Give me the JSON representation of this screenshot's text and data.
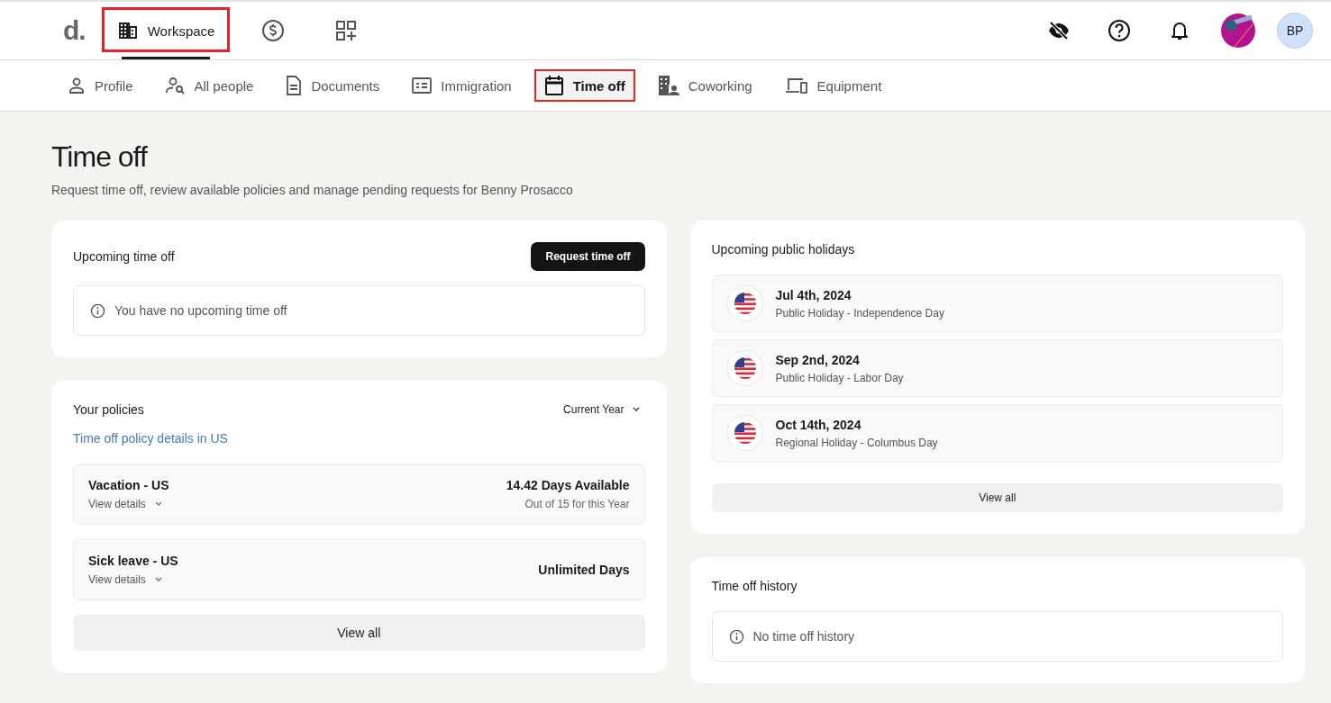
{
  "top_nav": {
    "logo": "d.",
    "items": [
      {
        "kind": "labeled",
        "label": "Workspace",
        "selected": true,
        "highlighted": true
      },
      {
        "kind": "icon",
        "selected": false,
        "highlighted": false
      },
      {
        "kind": "icon",
        "selected": false,
        "highlighted": false
      }
    ],
    "user_initials": "BP"
  },
  "tabs": [
    {
      "label": "Profile",
      "selected": false,
      "highlighted": false
    },
    {
      "label": "All people",
      "selected": false,
      "highlighted": false
    },
    {
      "label": "Documents",
      "selected": false,
      "highlighted": false
    },
    {
      "label": "Immigration",
      "selected": false,
      "highlighted": false
    },
    {
      "label": "Time off",
      "selected": true,
      "highlighted": true
    },
    {
      "label": "Coworking",
      "selected": false,
      "highlighted": false
    },
    {
      "label": "Equipment",
      "selected": false,
      "highlighted": false
    }
  ],
  "page": {
    "title": "Time off",
    "subtitle": "Request time off, review available policies and manage pending requests for Benny Prosacco"
  },
  "upcoming": {
    "title": "Upcoming time off",
    "button": "Request time off",
    "empty": "You have no upcoming time off"
  },
  "policies": {
    "title": "Your policies",
    "period": "Current Year",
    "link": "Time off policy details in US",
    "items": [
      {
        "name": "Vacation - US",
        "details": "View details",
        "available": "14.42 Days Available",
        "note": "Out of 15 for this Year"
      },
      {
        "name": "Sick leave - US",
        "details": "View details",
        "available": "Unlimited Days"
      }
    ],
    "view_all": "View all"
  },
  "holidays": {
    "title": "Upcoming public holidays",
    "items": [
      {
        "date": "Jul 4th, 2024",
        "description": "Public Holiday - Independence Day"
      },
      {
        "date": "Sep 2nd, 2024",
        "description": "Public Holiday - Labor Day"
      },
      {
        "date": "Oct 14th, 2024",
        "description": "Regional Holiday - Columbus Day"
      }
    ],
    "view_all": "View all"
  },
  "history": {
    "title": "Time off history",
    "empty": "No time off history"
  }
}
